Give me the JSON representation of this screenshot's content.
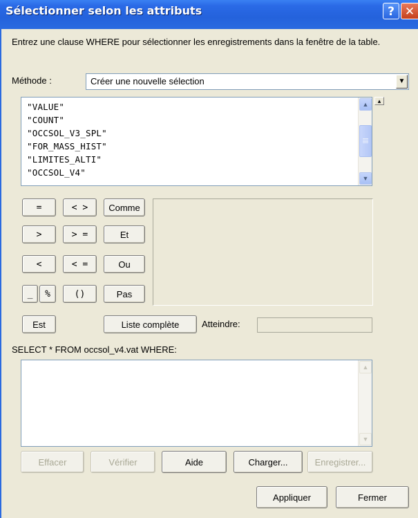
{
  "window": {
    "title": "Sélectionner selon les attributs",
    "help_label": "?",
    "close_label": "✕"
  },
  "description": "Entrez une clause WHERE pour sélectionner les enregistrements dans la fenêtre de la table.",
  "method": {
    "label": "Méthode :",
    "selected": "Créer une nouvelle sélection"
  },
  "fields": [
    "\"VALUE\"",
    "\"COUNT\"",
    "\"OCCSOL_V3_SPL\"",
    "\"FOR_MASS_HIST\"",
    "\"LIMITES_ALTI\"",
    "\"OCCSOL_V4\""
  ],
  "operators": {
    "eq": "=",
    "neq": "< >",
    "like": "Comme",
    "gt": ">",
    "gte": "> =",
    "and": "Et",
    "lt": "<",
    "lte": "< =",
    "or": "Ou",
    "underscore": "_",
    "percent": "%",
    "parens": "()",
    "not": "Pas",
    "is": "Est"
  },
  "unique_values": {
    "complete_list_label": "Liste complète",
    "reach_label": "Atteindre:",
    "reach_value": ""
  },
  "query": {
    "prefix": "SELECT * FROM occsol_v4.vat WHERE:",
    "text": ""
  },
  "actions": {
    "clear": "Effacer",
    "verify": "Vérifier",
    "help": "Aide",
    "load": "Charger...",
    "save": "Enregistrer..."
  },
  "footer": {
    "apply": "Appliquer",
    "close": "Fermer"
  }
}
